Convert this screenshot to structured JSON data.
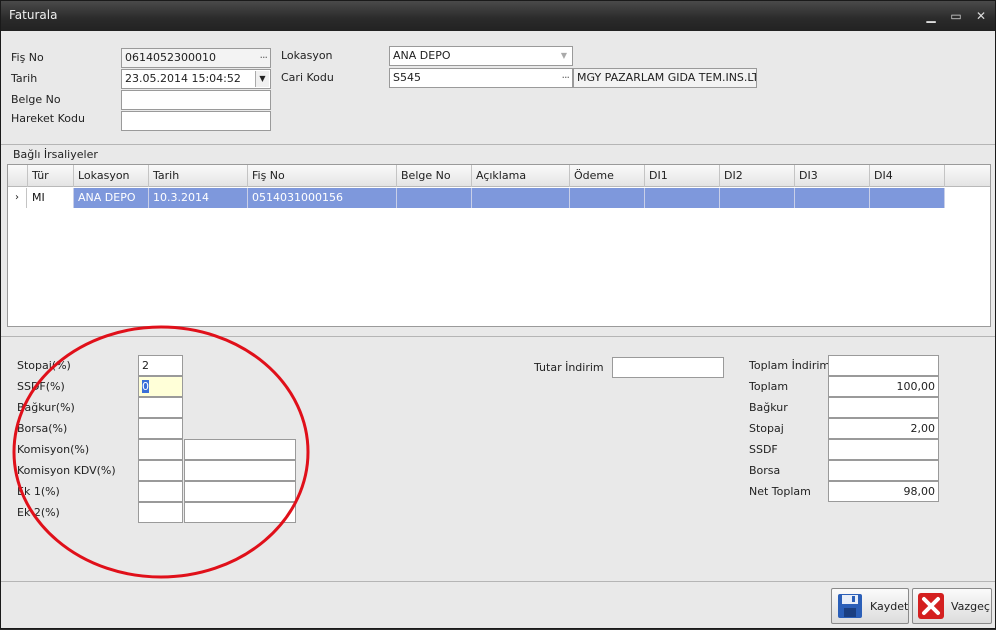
{
  "window": {
    "title": "Faturala",
    "minimize": "▁",
    "maximize": "▭",
    "close": "✕"
  },
  "header": {
    "fis_no_label": "Fiş No",
    "fis_no_value": "0614052300010",
    "tarih_label": "Tarih",
    "tarih_value": "23.05.2014 15:04:52",
    "belge_no_label": "Belge No",
    "belge_no_value": "",
    "hareket_kodu_label": "Hareket Kodu",
    "hareket_kodu_value": "",
    "lokasyon_label": "Lokasyon",
    "lokasyon_value": "ANA DEPO",
    "cari_kodu_label": "Cari Kodu",
    "cari_kodu_value": "S545",
    "cari_name": "MGY PAZARLAM GIDA TEM.INS.LT...",
    "ellipsis": "···",
    "dropdown_arrow": "▼"
  },
  "irsaliye": {
    "section_label": "Bağlı İrsaliyeler",
    "columns": [
      "Tür",
      "Lokasyon",
      "Tarih",
      "Fiş No",
      "Belge No",
      "Açıklama",
      "Ödeme",
      "DI1",
      "DI2",
      "DI3",
      "DI4"
    ],
    "row_indicator": "›",
    "rows": [
      {
        "tur": "MI",
        "lokasyon": "ANA DEPO",
        "tarih": "10.3.2014",
        "fis_no": "0514031000156",
        "belge_no": "",
        "aciklama": "",
        "odeme": "",
        "di1": "",
        "di2": "",
        "di3": "",
        "di4": ""
      }
    ]
  },
  "deductions": {
    "stopaj_label": "Stopaj(%)",
    "stopaj_value": "2",
    "ssdf_label": "SSDF(%)",
    "ssdf_value": "0",
    "bagkur_label": "Bağkur(%)",
    "bagkur_value": "",
    "borsa_label": "Borsa(%)",
    "borsa_value": "",
    "komisyon_label": "Komisyon(%)",
    "komisyon_value": "",
    "komisyon_amount": "",
    "komisyon_kdv_label": "Komisyon KDV(%)",
    "komisyon_kdv_value": "",
    "komisyon_kdv_amount": "",
    "ek1_label": "Ek 1(%)",
    "ek1_value": "",
    "ek1_amount": "",
    "ek2_label": "Ek 2(%)",
    "ek2_value": "",
    "ek2_amount": ""
  },
  "middle": {
    "tutar_indirim_label": "Tutar İndirim",
    "tutar_indirim_value": ""
  },
  "totals": {
    "toplam_indirim_label": "Toplam İndirim",
    "toplam_indirim_value": "",
    "toplam_label": "Toplam",
    "toplam_value": "100,00",
    "bagkur_label": "Bağkur",
    "bagkur_value": "",
    "stopaj_label": "Stopaj",
    "stopaj_value": "2,00",
    "ssdf_label": "SSDF",
    "ssdf_value": "",
    "borsa_label": "Borsa",
    "borsa_value": "",
    "net_toplam_label": "Net Toplam",
    "net_toplam_value": "98,00"
  },
  "buttons": {
    "kaydet": "Kaydet",
    "vazgec": "Vazgeç"
  },
  "colors": {
    "selected_row": "#7e98dc",
    "annotation": "#e0101a",
    "titlebar": "#2a2a2a"
  }
}
